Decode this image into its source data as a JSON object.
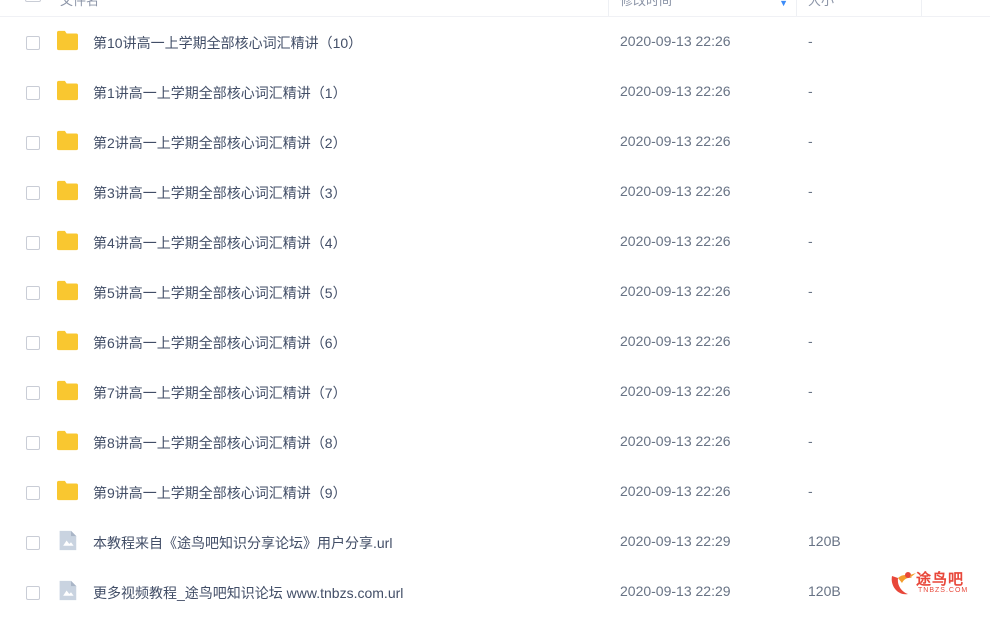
{
  "header": {
    "name_label": "文件名",
    "time_label": "修改时间",
    "size_label": "大小",
    "sort_icon": "sort-down-icon"
  },
  "files": [
    {
      "name": "第10讲高一上学期全部核心词汇精讲（10）",
      "time": "2020-09-13 22:26",
      "size": "-",
      "type": "folder"
    },
    {
      "name": "第1讲高一上学期全部核心词汇精讲（1）",
      "time": "2020-09-13 22:26",
      "size": "-",
      "type": "folder"
    },
    {
      "name": "第2讲高一上学期全部核心词汇精讲（2）",
      "time": "2020-09-13 22:26",
      "size": "-",
      "type": "folder"
    },
    {
      "name": "第3讲高一上学期全部核心词汇精讲（3）",
      "time": "2020-09-13 22:26",
      "size": "-",
      "type": "folder"
    },
    {
      "name": "第4讲高一上学期全部核心词汇精讲（4）",
      "time": "2020-09-13 22:26",
      "size": "-",
      "type": "folder"
    },
    {
      "name": "第5讲高一上学期全部核心词汇精讲（5）",
      "time": "2020-09-13 22:26",
      "size": "-",
      "type": "folder"
    },
    {
      "name": "第6讲高一上学期全部核心词汇精讲（6）",
      "time": "2020-09-13 22:26",
      "size": "-",
      "type": "folder"
    },
    {
      "name": "第7讲高一上学期全部核心词汇精讲（7）",
      "time": "2020-09-13 22:26",
      "size": "-",
      "type": "folder"
    },
    {
      "name": "第8讲高一上学期全部核心词汇精讲（8）",
      "time": "2020-09-13 22:26",
      "size": "-",
      "type": "folder"
    },
    {
      "name": "第9讲高一上学期全部核心词汇精讲（9）",
      "time": "2020-09-13 22:26",
      "size": "-",
      "type": "folder"
    },
    {
      "name": "本教程来自《途鸟吧知识分享论坛》用户分享.url",
      "time": "2020-09-13 22:29",
      "size": "120B",
      "type": "file"
    },
    {
      "name": "更多视频教程_途鸟吧知识论坛 www.tnbzs.com.url",
      "time": "2020-09-13 22:29",
      "size": "120B",
      "type": "file"
    }
  ],
  "watermark": {
    "text": "途鸟吧",
    "sub": "TNBZS.COM",
    "color": "#e8473a"
  },
  "colors": {
    "folder": "#f9c730",
    "file_icon": "#c9d3e0",
    "accent": "#3d8cf8"
  }
}
